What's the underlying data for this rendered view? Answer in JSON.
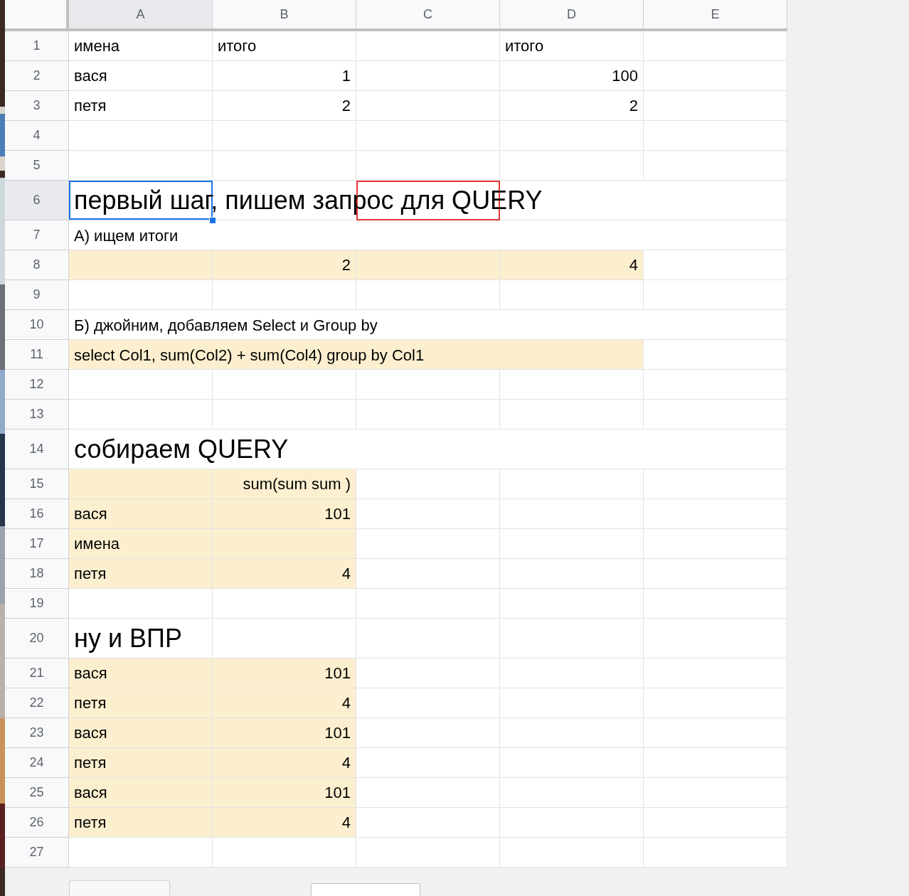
{
  "columns": [
    "A",
    "B",
    "C",
    "D",
    "E"
  ],
  "rows": [
    {
      "number": "1",
      "kind": "normal",
      "cells": [
        {
          "text": "имена",
          "kind": "text",
          "highlighted": false,
          "selected": false,
          "marked": false
        },
        {
          "text": "итого",
          "kind": "text",
          "highlighted": false,
          "selected": false,
          "marked": false
        },
        {
          "highlighted": false,
          "selected": false,
          "marked": false
        },
        {
          "text": "итого",
          "kind": "text",
          "highlighted": false,
          "selected": false,
          "marked": false
        },
        {
          "highlighted": false,
          "selected": false,
          "marked": false
        }
      ]
    },
    {
      "number": "2",
      "kind": "normal",
      "cells": [
        {
          "text": "вася",
          "kind": "text",
          "highlighted": false,
          "selected": false,
          "marked": false
        },
        {
          "text": "1",
          "kind": "number",
          "highlighted": false,
          "selected": false,
          "marked": false
        },
        {
          "highlighted": false,
          "selected": false,
          "marked": false
        },
        {
          "text": "100",
          "kind": "number",
          "highlighted": false,
          "selected": false,
          "marked": false
        },
        {
          "highlighted": false,
          "selected": false,
          "marked": false
        }
      ]
    },
    {
      "number": "3",
      "kind": "normal",
      "cells": [
        {
          "text": "петя",
          "kind": "text",
          "highlighted": false,
          "selected": false,
          "marked": false
        },
        {
          "text": "2",
          "kind": "number",
          "highlighted": false,
          "selected": false,
          "marked": false
        },
        {
          "highlighted": false,
          "selected": false,
          "marked": false
        },
        {
          "text": "2",
          "kind": "number",
          "highlighted": false,
          "selected": false,
          "marked": false
        },
        {
          "highlighted": false,
          "selected": false,
          "marked": false
        }
      ]
    },
    {
      "number": "4",
      "kind": "normal",
      "cells": [
        {
          "highlighted": false,
          "selected": false,
          "marked": false
        },
        {
          "highlighted": false,
          "selected": false,
          "marked": false
        },
        {
          "highlighted": false,
          "selected": false,
          "marked": false
        },
        {
          "highlighted": false,
          "selected": false,
          "marked": false
        },
        {
          "highlighted": false,
          "selected": false,
          "marked": false
        }
      ]
    },
    {
      "number": "5",
      "kind": "normal",
      "cells": [
        {
          "highlighted": false,
          "selected": false,
          "marked": false
        },
        {
          "highlighted": false,
          "selected": false,
          "marked": false
        },
        {
          "highlighted": false,
          "selected": false,
          "marked": false
        },
        {
          "highlighted": false,
          "selected": false,
          "marked": false
        },
        {
          "highlighted": false,
          "selected": false,
          "marked": false
        }
      ]
    },
    {
      "number": "6",
      "kind": "heading",
      "cells": [
        {
          "text": "первый шаг, пишем запрос для QUERY",
          "kind": "wide_text",
          "highlighted": false,
          "selected": true,
          "marked": false
        },
        {
          "highlighted": false,
          "selected": false,
          "marked": false
        },
        {
          "highlighted": false,
          "selected": false,
          "marked": true
        },
        {
          "highlighted": false,
          "selected": false,
          "marked": false
        },
        {
          "highlighted": false,
          "selected": false,
          "marked": false
        }
      ]
    },
    {
      "number": "7",
      "kind": "normal",
      "cells": [
        {
          "text": "А) ищем итоги",
          "kind": "wide_text",
          "highlighted": false,
          "selected": false,
          "marked": false
        },
        {
          "highlighted": false,
          "selected": false,
          "marked": false
        },
        {
          "highlighted": false,
          "selected": false,
          "marked": false
        },
        {
          "highlighted": false,
          "selected": false,
          "marked": false
        },
        {
          "highlighted": false,
          "selected": false,
          "marked": false
        }
      ]
    },
    {
      "number": "8",
      "kind": "normal",
      "cells": [
        {
          "highlighted": true,
          "selected": false,
          "marked": false
        },
        {
          "text": "2",
          "kind": "number",
          "highlighted": true,
          "selected": false,
          "marked": false
        },
        {
          "highlighted": true,
          "selected": false,
          "marked": false
        },
        {
          "text": "4",
          "kind": "number",
          "highlighted": true,
          "selected": false,
          "marked": false
        },
        {
          "highlighted": false,
          "selected": false,
          "marked": false
        }
      ]
    },
    {
      "number": "9",
      "kind": "normal",
      "cells": [
        {
          "highlighted": false,
          "selected": false,
          "marked": false
        },
        {
          "highlighted": false,
          "selected": false,
          "marked": false
        },
        {
          "highlighted": false,
          "selected": false,
          "marked": false
        },
        {
          "highlighted": false,
          "selected": false,
          "marked": false
        },
        {
          "highlighted": false,
          "selected": false,
          "marked": false
        }
      ]
    },
    {
      "number": "10",
      "kind": "normal",
      "cells": [
        {
          "text": "Б) джойним, добавляем Select и Group by",
          "kind": "wide_text",
          "highlighted": false,
          "selected": false,
          "marked": false
        },
        {
          "highlighted": false,
          "selected": false,
          "marked": false
        },
        {
          "highlighted": false,
          "selected": false,
          "marked": false
        },
        {
          "highlighted": false,
          "selected": false,
          "marked": false
        },
        {
          "highlighted": false,
          "selected": false,
          "marked": false
        }
      ]
    },
    {
      "number": "11",
      "kind": "normal",
      "cells": [
        {
          "text": "select Col1, sum(Col2) + sum(Col4) group by Col1",
          "kind": "wide_text",
          "highlighted": true,
          "selected": false,
          "marked": false
        },
        {
          "highlighted": true,
          "selected": false,
          "marked": false
        },
        {
          "highlighted": true,
          "selected": false,
          "marked": false
        },
        {
          "highlighted": true,
          "selected": false,
          "marked": false
        },
        {
          "highlighted": false,
          "selected": false,
          "marked": false
        }
      ]
    },
    {
      "number": "12",
      "kind": "normal",
      "cells": [
        {
          "highlighted": false,
          "selected": false,
          "marked": false
        },
        {
          "highlighted": false,
          "selected": false,
          "marked": false
        },
        {
          "highlighted": false,
          "selected": false,
          "marked": false
        },
        {
          "highlighted": false,
          "selected": false,
          "marked": false
        },
        {
          "highlighted": false,
          "selected": false,
          "marked": false
        }
      ]
    },
    {
      "number": "13",
      "kind": "normal",
      "cells": [
        {
          "highlighted": false,
          "selected": false,
          "marked": false
        },
        {
          "highlighted": false,
          "selected": false,
          "marked": false
        },
        {
          "highlighted": false,
          "selected": false,
          "marked": false
        },
        {
          "highlighted": false,
          "selected": false,
          "marked": false
        },
        {
          "highlighted": false,
          "selected": false,
          "marked": false
        }
      ]
    },
    {
      "number": "14",
      "kind": "heading",
      "cells": [
        {
          "text": "собираем QUERY",
          "kind": "wide_text",
          "highlighted": false,
          "selected": false,
          "marked": false
        },
        {
          "highlighted": false,
          "selected": false,
          "marked": false
        },
        {
          "highlighted": false,
          "selected": false,
          "marked": false
        },
        {
          "highlighted": false,
          "selected": false,
          "marked": false
        },
        {
          "highlighted": false,
          "selected": false,
          "marked": false
        }
      ]
    },
    {
      "number": "15",
      "kind": "normal",
      "cells": [
        {
          "highlighted": true,
          "selected": false,
          "marked": false
        },
        {
          "text": "sum(sum sum )",
          "kind": "number",
          "highlighted": true,
          "selected": false,
          "marked": false
        },
        {
          "highlighted": false,
          "selected": false,
          "marked": false
        },
        {
          "highlighted": false,
          "selected": false,
          "marked": false
        },
        {
          "highlighted": false,
          "selected": false,
          "marked": false
        }
      ]
    },
    {
      "number": "16",
      "kind": "normal",
      "cells": [
        {
          "text": "вася",
          "kind": "text",
          "highlighted": true,
          "selected": false,
          "marked": false
        },
        {
          "text": "101",
          "kind": "number",
          "highlighted": true,
          "selected": false,
          "marked": false
        },
        {
          "highlighted": false,
          "selected": false,
          "marked": false
        },
        {
          "highlighted": false,
          "selected": false,
          "marked": false
        },
        {
          "highlighted": false,
          "selected": false,
          "marked": false
        }
      ]
    },
    {
      "number": "17",
      "kind": "normal",
      "cells": [
        {
          "text": "имена",
          "kind": "text",
          "highlighted": true,
          "selected": false,
          "marked": false
        },
        {
          "highlighted": true,
          "selected": false,
          "marked": false
        },
        {
          "highlighted": false,
          "selected": false,
          "marked": false
        },
        {
          "highlighted": false,
          "selected": false,
          "marked": false
        },
        {
          "highlighted": false,
          "selected": false,
          "marked": false
        }
      ]
    },
    {
      "number": "18",
      "kind": "normal",
      "cells": [
        {
          "text": "петя",
          "kind": "text",
          "highlighted": true,
          "selected": false,
          "marked": false
        },
        {
          "text": "4",
          "kind": "number",
          "highlighted": true,
          "selected": false,
          "marked": false
        },
        {
          "highlighted": false,
          "selected": false,
          "marked": false
        },
        {
          "highlighted": false,
          "selected": false,
          "marked": false
        },
        {
          "highlighted": false,
          "selected": false,
          "marked": false
        }
      ]
    },
    {
      "number": "19",
      "kind": "normal",
      "cells": [
        {
          "highlighted": false,
          "selected": false,
          "marked": false
        },
        {
          "highlighted": false,
          "selected": false,
          "marked": false
        },
        {
          "highlighted": false,
          "selected": false,
          "marked": false
        },
        {
          "highlighted": false,
          "selected": false,
          "marked": false
        },
        {
          "highlighted": false,
          "selected": false,
          "marked": false
        }
      ]
    },
    {
      "number": "20",
      "kind": "heading",
      "cells": [
        {
          "text": "ну и ВПР",
          "kind": "text",
          "highlighted": false,
          "selected": false,
          "marked": false
        },
        {
          "highlighted": false,
          "selected": false,
          "marked": false
        },
        {
          "highlighted": false,
          "selected": false,
          "marked": false
        },
        {
          "highlighted": false,
          "selected": false,
          "marked": false
        },
        {
          "highlighted": false,
          "selected": false,
          "marked": false
        }
      ]
    },
    {
      "number": "21",
      "kind": "normal",
      "cells": [
        {
          "text": "вася",
          "kind": "text",
          "highlighted": true,
          "selected": false,
          "marked": false
        },
        {
          "text": "101",
          "kind": "number",
          "highlighted": true,
          "selected": false,
          "marked": false
        },
        {
          "highlighted": false,
          "selected": false,
          "marked": false
        },
        {
          "highlighted": false,
          "selected": false,
          "marked": false
        },
        {
          "highlighted": false,
          "selected": false,
          "marked": false
        }
      ]
    },
    {
      "number": "22",
      "kind": "normal",
      "cells": [
        {
          "text": "петя",
          "kind": "text",
          "highlighted": true,
          "selected": false,
          "marked": false
        },
        {
          "text": "4",
          "kind": "number",
          "highlighted": true,
          "selected": false,
          "marked": false
        },
        {
          "highlighted": false,
          "selected": false,
          "marked": false
        },
        {
          "highlighted": false,
          "selected": false,
          "marked": false
        },
        {
          "highlighted": false,
          "selected": false,
          "marked": false
        }
      ]
    },
    {
      "number": "23",
      "kind": "normal",
      "cells": [
        {
          "text": "вася",
          "kind": "text",
          "highlighted": true,
          "selected": false,
          "marked": false
        },
        {
          "text": "101",
          "kind": "number",
          "highlighted": true,
          "selected": false,
          "marked": false
        },
        {
          "highlighted": false,
          "selected": false,
          "marked": false
        },
        {
          "highlighted": false,
          "selected": false,
          "marked": false
        },
        {
          "highlighted": false,
          "selected": false,
          "marked": false
        }
      ]
    },
    {
      "number": "24",
      "kind": "normal",
      "cells": [
        {
          "text": "петя",
          "kind": "text",
          "highlighted": true,
          "selected": false,
          "marked": false
        },
        {
          "text": "4",
          "kind": "number",
          "highlighted": true,
          "selected": false,
          "marked": false
        },
        {
          "highlighted": false,
          "selected": false,
          "marked": false
        },
        {
          "highlighted": false,
          "selected": false,
          "marked": false
        },
        {
          "highlighted": false,
          "selected": false,
          "marked": false
        }
      ]
    },
    {
      "number": "25",
      "kind": "normal",
      "cells": [
        {
          "text": "вася",
          "kind": "text",
          "highlighted": true,
          "selected": false,
          "marked": false
        },
        {
          "text": "101",
          "kind": "number",
          "highlighted": true,
          "selected": false,
          "marked": false
        },
        {
          "highlighted": false,
          "selected": false,
          "marked": false
        },
        {
          "highlighted": false,
          "selected": false,
          "marked": false
        },
        {
          "highlighted": false,
          "selected": false,
          "marked": false
        }
      ]
    },
    {
      "number": "26",
      "kind": "normal",
      "cells": [
        {
          "text": "петя",
          "kind": "text",
          "highlighted": true,
          "selected": false,
          "marked": false
        },
        {
          "text": "4",
          "kind": "number",
          "highlighted": true,
          "selected": false,
          "marked": false
        },
        {
          "highlighted": false,
          "selected": false,
          "marked": false
        },
        {
          "highlighted": false,
          "selected": false,
          "marked": false
        },
        {
          "highlighted": false,
          "selected": false,
          "marked": false
        }
      ]
    },
    {
      "number": "27",
      "kind": "normal",
      "cells": [
        {
          "highlighted": false,
          "selected": false,
          "marked": false
        },
        {
          "highlighted": false,
          "selected": false,
          "marked": false
        },
        {
          "highlighted": false,
          "selected": false,
          "marked": false
        },
        {
          "highlighted": false,
          "selected": false,
          "marked": false
        },
        {
          "highlighted": false,
          "selected": false,
          "marked": false
        }
      ]
    }
  ]
}
